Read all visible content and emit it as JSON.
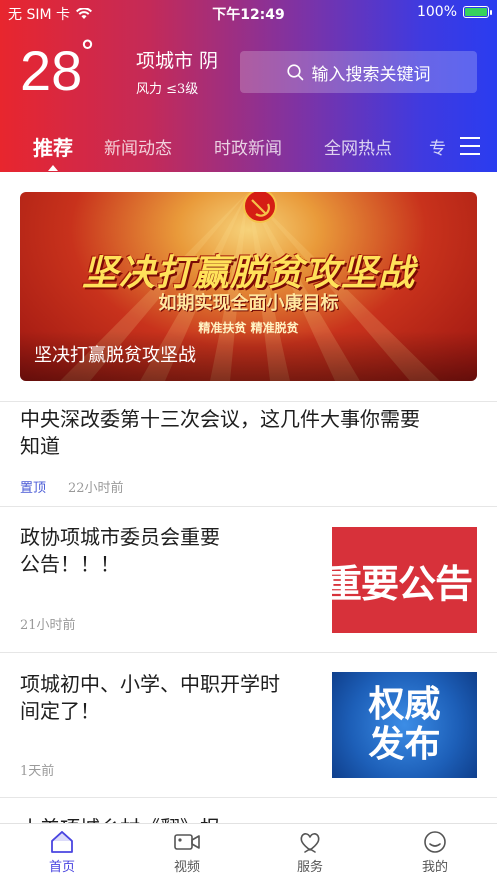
{
  "status_bar": {
    "carrier": "无 SIM 卡",
    "time": "下午12:49",
    "battery": "100%",
    "battery_level": 1.0
  },
  "weather": {
    "temperature": "28",
    "degree_symbol": "°",
    "city_weather": "项城市 阴",
    "wind": "风力 ≤3级"
  },
  "search": {
    "placeholder": "输入搜索关键词"
  },
  "tabs": [
    {
      "label": "推荐",
      "active": true
    },
    {
      "label": "新闻动态"
    },
    {
      "label": "时政新闻"
    },
    {
      "label": "全网热点"
    },
    {
      "label": "专"
    }
  ],
  "banner": {
    "main_text": "坚决打赢脱贫攻坚战",
    "sub_text": "如期实现全面小康目标",
    "tag_text": "精准扶贫 精准脱贫",
    "caption": "坚决打赢脱贫攻坚战"
  },
  "articles": [
    {
      "title_line1": "中央深改委第十三次会议，这几件大事你需要",
      "title_line2": "知道",
      "pin": "置顶",
      "time": "22小时前"
    },
    {
      "title_line1": "政协项城市委员会重要",
      "title_line2": "公告！！！",
      "time": "21小时前",
      "thumb_text": "重要公告"
    },
    {
      "title_line1": "项城初中、小学、中职开学时",
      "title_line2": "间定了！",
      "time": "1天前",
      "thumb_line1": "权威",
      "thumb_line2": "发布"
    },
    {
      "title_line1": "小美项城乡村《翻》报"
    }
  ],
  "bottom_nav": [
    {
      "label": "首页",
      "icon": "home-icon",
      "active": true
    },
    {
      "label": "视频",
      "icon": "video-icon"
    },
    {
      "label": "服务",
      "icon": "heart-hand-icon"
    },
    {
      "label": "我的",
      "icon": "smile-icon"
    }
  ],
  "colors": {
    "gradient_start": "#e8262e",
    "gradient_end": "#2a3cf0",
    "accent": "#4a45e0",
    "pin": "#4a5bd6"
  }
}
